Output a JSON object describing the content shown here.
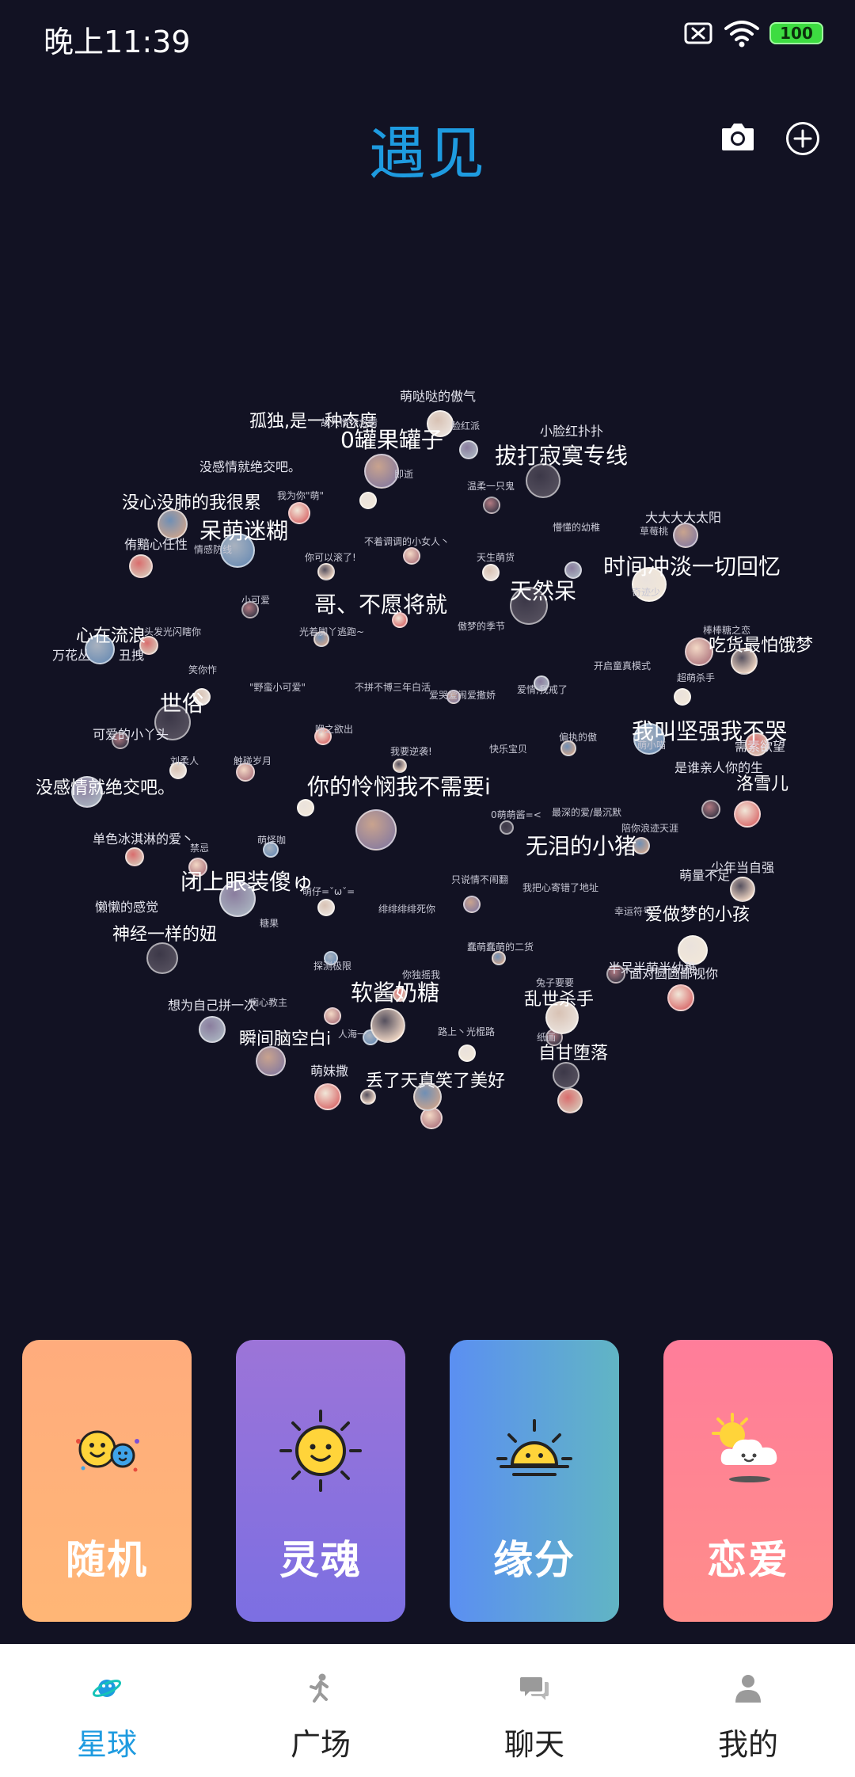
{
  "status_bar": {
    "time": "晚上11:39",
    "battery": "100",
    "sim_icon": "sim-off-icon",
    "wifi_icon": "wifi-icon"
  },
  "header": {
    "title": "遇见",
    "camera_icon": "camera-icon",
    "add_icon": "plus-circle-icon"
  },
  "sphere_tags": [
    {
      "text": "萌哒哒的傲气",
      "s": 3
    },
    {
      "text": "孤独,是一种态度",
      "s": 2
    },
    {
      "text": "故人情怀念情",
      "s": 4
    },
    {
      "text": "0罐果罐子",
      "s": 1
    },
    {
      "text": "脸红派",
      "s": 4
    },
    {
      "text": "小脸红扑扑",
      "s": 3
    },
    {
      "text": "拔打寂寞专线",
      "s": 1
    },
    {
      "text": "没感情就绝交吧。",
      "s": 3
    },
    {
      "text": "即逝",
      "s": 4
    },
    {
      "text": "温柔一只鬼",
      "s": 4
    },
    {
      "text": "没心没肺的我很累",
      "s": 2
    },
    {
      "text": "我为你\"萌\"",
      "s": 4
    },
    {
      "text": "呆萌迷糊",
      "s": 1
    },
    {
      "text": "懵懂的幼稚",
      "s": 4
    },
    {
      "text": "大大大大太阳",
      "s": 3
    },
    {
      "text": "草莓桃",
      "s": 4
    },
    {
      "text": "侑黯心任性",
      "s": 3
    },
    {
      "text": "情感防线",
      "s": 4
    },
    {
      "text": "不着调调的小女人丶",
      "s": 4
    },
    {
      "text": "你可以滚了!",
      "s": 4
    },
    {
      "text": "天生萌货",
      "s": 4
    },
    {
      "text": "时间冲淡一切回忆",
      "s": 1
    },
    {
      "text": "小可爱",
      "s": 4
    },
    {
      "text": "哥、不愿将就",
      "s": 1
    },
    {
      "text": "天然呆",
      "s": 1
    },
    {
      "text": "奇迹少",
      "s": 4
    },
    {
      "text": "心在流浪",
      "s": 2
    },
    {
      "text": "头发光闪瞎你",
      "s": 4
    },
    {
      "text": "光着脚丫逃跑~",
      "s": 4
    },
    {
      "text": "傲梦的季节",
      "s": 4
    },
    {
      "text": "棒棒糖之恋",
      "s": 4
    },
    {
      "text": "吃货最怕饿梦",
      "s": 2
    },
    {
      "text": "万花丛",
      "s": 3
    },
    {
      "text": "丑拽",
      "s": 3
    },
    {
      "text": "笑你怍",
      "s": 4
    },
    {
      "text": "开启童真模式",
      "s": 4
    },
    {
      "text": "超萌杀手",
      "s": 4
    },
    {
      "text": "\"野蛮小可爱\"",
      "s": 4
    },
    {
      "text": "不拼不博三年白活",
      "s": 4
    },
    {
      "text": "爱情,我戒了",
      "s": 4
    },
    {
      "text": "世俗",
      "s": 1
    },
    {
      "text": "爱哭爱闹爱撒娇",
      "s": 4
    },
    {
      "text": "我叫坚强我不哭",
      "s": 1
    },
    {
      "text": "可爱的小丫头",
      "s": 3
    },
    {
      "text": "咿之欲出",
      "s": 4
    },
    {
      "text": "偏执的傲",
      "s": 4
    },
    {
      "text": "萌小喵",
      "s": 4
    },
    {
      "text": "需素欲望",
      "s": 3
    },
    {
      "text": "刘柔人",
      "s": 4
    },
    {
      "text": "快乐宝贝",
      "s": 4
    },
    {
      "text": "我要逆袭!",
      "s": 4
    },
    {
      "text": "触碰岁月",
      "s": 4
    },
    {
      "text": "是谁亲人你的生",
      "s": 3
    },
    {
      "text": "没感情就绝交吧。",
      "s": 2
    },
    {
      "text": "你的怜悯我不需要i",
      "s": 1
    },
    {
      "text": "洛雪儿",
      "s": 2
    },
    {
      "text": "0萌萌酱=<",
      "s": 4
    },
    {
      "text": "最深的爱/最沉默",
      "s": 4
    },
    {
      "text": "陪你浪迹天涯",
      "s": 4
    },
    {
      "text": "单色冰淇淋的爱丶",
      "s": 3
    },
    {
      "text": "无泪的小猪",
      "s": 1
    },
    {
      "text": "萌怪咖",
      "s": 4
    },
    {
      "text": "禁忌",
      "s": 4
    },
    {
      "text": "少年当自强",
      "s": 3
    },
    {
      "text": "萌量不足",
      "s": 3
    },
    {
      "text": "闭上眼装傻ゅ",
      "s": 1
    },
    {
      "text": "只说情不闹翻",
      "s": 4
    },
    {
      "text": "我把心寄错了地址",
      "s": 4
    },
    {
      "text": "萌仔=ˇωˇ=",
      "s": 4
    },
    {
      "text": "懒懒的感觉",
      "s": 3
    },
    {
      "text": "糖果",
      "s": 4
    },
    {
      "text": "绯绯绯绯死你",
      "s": 4
    },
    {
      "text": "幸运符号",
      "s": 4
    },
    {
      "text": "爱做梦的小孩",
      "s": 2
    },
    {
      "text": "神经一样的妞",
      "s": 2
    },
    {
      "text": "蠢萌蠢萌的二货",
      "s": 4
    },
    {
      "text": "探测极限",
      "s": 4
    },
    {
      "text": "半呆半萌半幼稚",
      "s": 3
    },
    {
      "text": "面对圆圆鄙视你",
      "s": 3
    },
    {
      "text": "你独摇我",
      "s": 4
    },
    {
      "text": "兔子要要",
      "s": 4
    },
    {
      "text": "软酱奶糖",
      "s": 1
    },
    {
      "text": "想为自己拼一次",
      "s": 3
    },
    {
      "text": "痴心教主",
      "s": 4
    },
    {
      "text": "乱世杀手",
      "s": 2
    },
    {
      "text": "人海一",
      "s": 4
    },
    {
      "text": "路上丶光棍路",
      "s": 4
    },
    {
      "text": "瞬间脑空白i",
      "s": 2
    },
    {
      "text": "纸画",
      "s": 4
    },
    {
      "text": "自甘堕落",
      "s": 2
    },
    {
      "text": "萌妹撒",
      "s": 3
    },
    {
      "text": "丢了天真笑了美好",
      "s": 2
    }
  ],
  "cards": [
    {
      "label": "随机",
      "icon": "two-faces-icon"
    },
    {
      "label": "灵魂",
      "icon": "sun-icon"
    },
    {
      "label": "缘分",
      "icon": "sunrise-icon"
    },
    {
      "label": "恋爱",
      "icon": "sun-cloud-icon"
    }
  ],
  "nav": [
    {
      "label": "星球",
      "icon": "planet-icon"
    },
    {
      "label": "广场",
      "icon": "dancer-icon"
    },
    {
      "label": "聊天",
      "icon": "chat-bubbles-icon"
    },
    {
      "label": "我的",
      "icon": "person-icon"
    }
  ],
  "colors": {
    "accent": "#1e9be0",
    "background": "#121223",
    "nav_background": "#ffffff"
  }
}
